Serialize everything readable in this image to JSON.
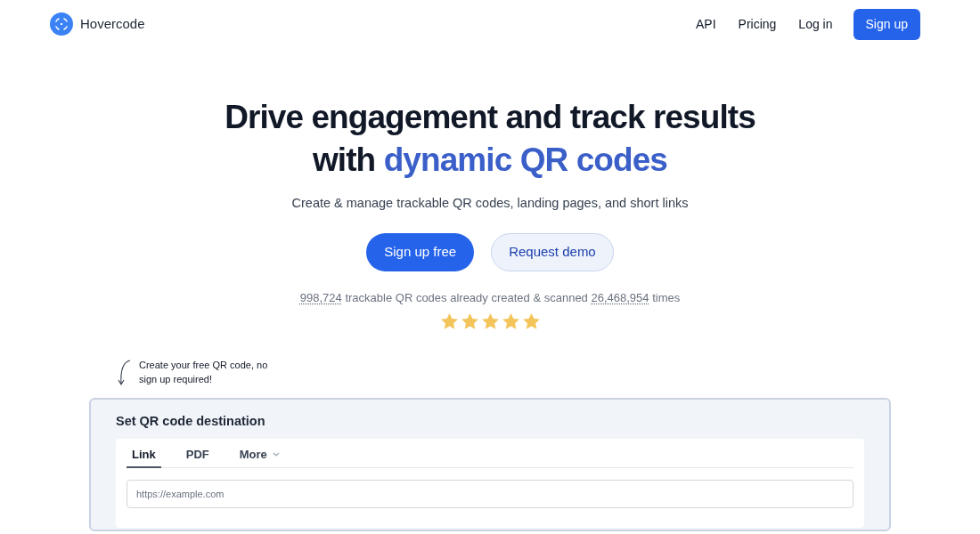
{
  "header": {
    "brand": "Hovercode",
    "nav": [
      {
        "label": "API",
        "kind": "link"
      },
      {
        "label": "Pricing",
        "kind": "link"
      },
      {
        "label": "Log in",
        "kind": "link"
      },
      {
        "label": "Sign up",
        "kind": "button"
      }
    ]
  },
  "hero": {
    "title_line_1": "Drive engagement and track results",
    "title_line_2_prefix": "with",
    "title_line_2_highlight": "dynamic QR codes",
    "subtitle": "Create & manage trackable QR codes, landing pages, and short links",
    "buttons": [
      {
        "label": "Sign up free",
        "kind": "primary"
      },
      {
        "label": "Request demo",
        "kind": "secondary"
      }
    ],
    "stats": [
      {
        "kind": "number",
        "text": "998,724"
      },
      {
        "kind": "text",
        "text": " trackable QR codes already created & scanned "
      },
      {
        "kind": "number",
        "text": "26,468,954"
      },
      {
        "kind": "text",
        "text": " times"
      }
    ],
    "stars": 5
  },
  "note": "Create your free QR code, no sign up required!",
  "generator": {
    "title": "Set QR code destination",
    "tabs": [
      {
        "label": "Link",
        "selected": true,
        "dropdown": false
      },
      {
        "label": "PDF",
        "selected": false,
        "dropdown": false
      },
      {
        "label": "More",
        "selected": false,
        "dropdown": true
      }
    ],
    "url_field": {
      "placeholder": "https://example.com"
    }
  }
}
